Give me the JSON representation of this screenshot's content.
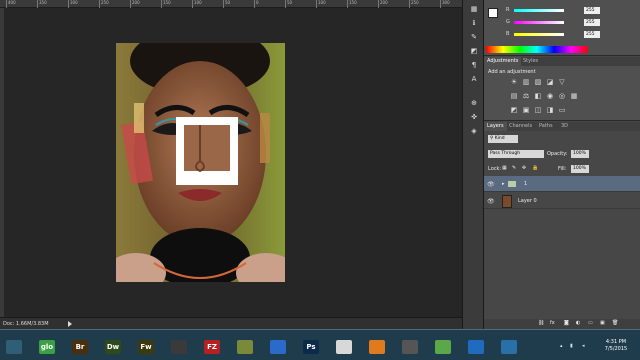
{
  "ruler": {
    "ticks": [
      "400",
      "350",
      "300",
      "250",
      "200",
      "150",
      "100",
      "50",
      "0",
      "50",
      "100",
      "150",
      "200",
      "250",
      "300"
    ]
  },
  "status": {
    "doc": "Doc: 1.66M/3.83M"
  },
  "color": {
    "rows": [
      {
        "label": "R",
        "value": "255",
        "bar_color": "#ff4444"
      },
      {
        "label": "G",
        "value": "255",
        "bar_color": "#44dd44"
      },
      {
        "label": "B",
        "value": "255",
        "bar_color": "#4466ff"
      }
    ]
  },
  "adjustments": {
    "tabs": [
      "Adjustments",
      "Styles"
    ],
    "heading": "Add an adjustment",
    "icons": [
      "brightness-contrast-icon",
      "levels-icon",
      "curves-icon",
      "exposure-icon",
      "vibrance-icon",
      "hue-saturation-icon",
      "color-balance-icon",
      "black-white-icon",
      "photo-filter-icon",
      "channel-mixer-icon",
      "color-lookup-icon",
      "invert-icon",
      "posterize-icon",
      "threshold-icon",
      "selective-color-icon",
      "gradient-map-icon"
    ]
  },
  "layers": {
    "tabs": [
      "Layers",
      "Channels",
      "Paths",
      "3D"
    ],
    "kind": "Kind",
    "blend_mode": "Pass Through",
    "opacity_label": "Opacity:",
    "opacity": "100%",
    "lock_label": "Lock:",
    "fill_label": "Fill:",
    "fill": "100%",
    "items": [
      {
        "name": "1",
        "type": "group"
      },
      {
        "name": "Layer 0",
        "type": "image"
      }
    ]
  },
  "taskbar": {
    "apps": [
      {
        "name": "start-button",
        "label": "",
        "color": "#2f5f77"
      },
      {
        "name": "glo-app",
        "label": "glo",
        "color": "#3aa142"
      },
      {
        "name": "bridge-app",
        "label": "Br",
        "color": "#4a2f0f"
      },
      {
        "name": "dreamweaver-app",
        "label": "Dw",
        "color": "#2f4a1a"
      },
      {
        "name": "fireworks-app",
        "label": "Fw",
        "color": "#3d3a0f"
      },
      {
        "name": "creative-cloud-app",
        "label": "",
        "color": "#3a3a3a"
      },
      {
        "name": "filezilla-app",
        "label": "FZ",
        "color": "#b52020"
      },
      {
        "name": "notepad-app",
        "label": "",
        "color": "#7a8a3a"
      },
      {
        "name": "firefox-app",
        "label": "",
        "color": "#2a6ac9"
      },
      {
        "name": "photoshop-app",
        "label": "Ps",
        "color": "#0c2a4a"
      },
      {
        "name": "chrome-app",
        "label": "",
        "color": "#d8d8d8"
      },
      {
        "name": "xampp-app",
        "label": "",
        "color": "#e07a1f"
      },
      {
        "name": "terminal-app",
        "label": "",
        "color": "#555555"
      },
      {
        "name": "inkscape-app",
        "label": "",
        "color": "#5aa84a"
      },
      {
        "name": "outlook-app",
        "label": "",
        "color": "#1f6bbf"
      },
      {
        "name": "ie-app",
        "label": "",
        "color": "#2a6fa8"
      }
    ],
    "time": "4:31 PM",
    "date": "7/5/2015"
  }
}
